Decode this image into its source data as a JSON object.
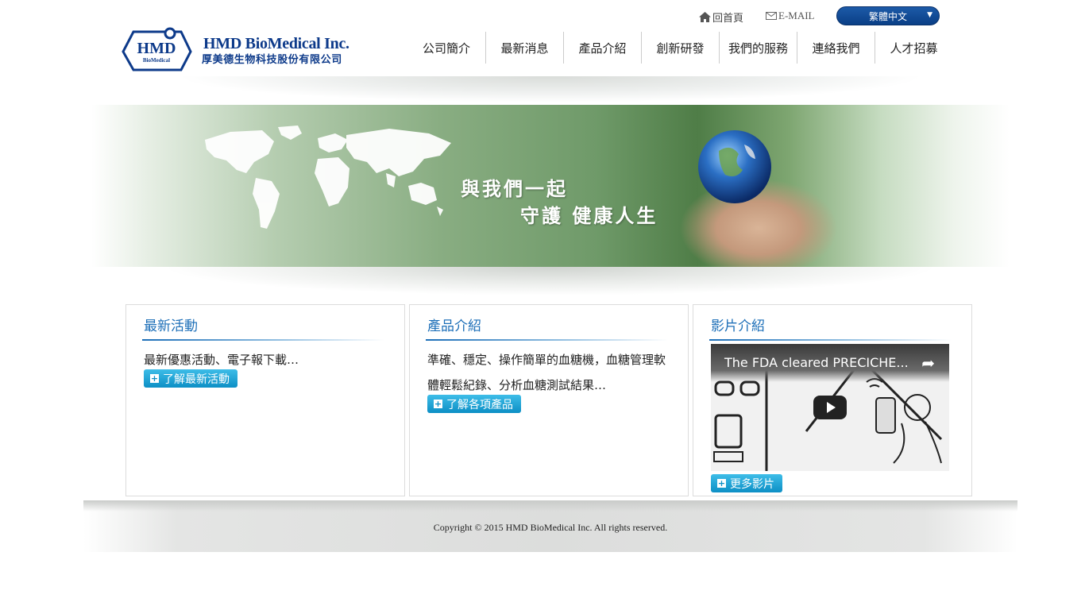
{
  "util": {
    "home_icon": "home-icon",
    "home_label": "回首頁",
    "mail_icon": "envelope-icon",
    "mail_label": "E-MAIL",
    "language_selected": "繁體中文"
  },
  "logo": {
    "mark_text": "HMD",
    "mark_sub": "BioMedical",
    "name_en": "HMD BioMedical Inc.",
    "name_zh": "厚美德生物科技股份有限公司"
  },
  "nav": {
    "items": [
      "公司簡介",
      "最新消息",
      "產品介紹",
      "創新研發",
      "我們的服務",
      "連絡我們",
      "人才招募"
    ]
  },
  "banner": {
    "line1": "與我們一起",
    "line2": "守護  健康人生"
  },
  "boxes": {
    "news": {
      "title": "最新活動",
      "text": "最新優惠活動、電子報下載…",
      "button": "了解最新活動"
    },
    "products": {
      "title": "產品介紹",
      "text": "準確、穩定、操作簡單的血糖機，血糖管理軟體輕鬆紀錄、分析血糖測試結果…",
      "button": "了解各項產品"
    },
    "videos": {
      "title": "影片介紹",
      "video_title": "The FDA cleared PRECICHE...",
      "button": "更多影片"
    }
  },
  "footer": {
    "copyright": "Copyright © 2015 HMD BioMedical Inc. All rights reserved."
  },
  "colors": {
    "brand_blue": "#0d3a8a",
    "accent_blue": "#1d6fb8",
    "button_cyan": "#0d8fc5",
    "banner_green": "#6f9a69"
  }
}
